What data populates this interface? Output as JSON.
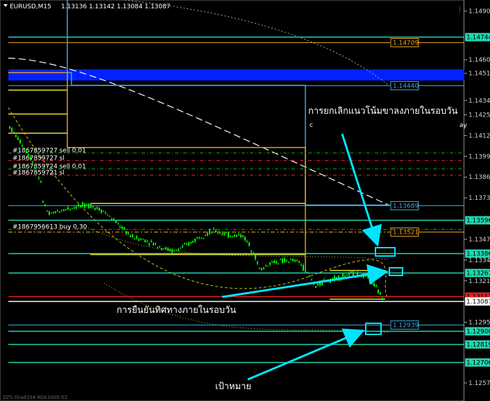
{
  "window": {
    "title": "EURUSD,M15",
    "ohlc": "1.13136 1.13142 1.13084 1.13087",
    "footer_text": "ZZS-Grad334 8DA1005-02",
    "top_right_icon": "scrollbar-marker-icon"
  },
  "chart_data": {
    "type": "candlestick",
    "symbol": "EURUSD",
    "timeframe": "M15",
    "ylim": [
      1.1245,
      1.1498
    ],
    "price_axis_ticks": [
      "1.14905",
      "1.14600",
      "1.14515",
      "1.14345",
      "1.14255",
      "1.14125",
      "1.13995",
      "1.13865",
      "1.13735",
      "1.13605",
      "1.13475",
      "1.13345",
      "1.13215",
      "1.13085",
      "1.12955",
      "1.12825",
      "1.12695",
      "1.12575"
    ],
    "axis_labels": {
      "top": "1.14905",
      "ticks": [
        "1.14600",
        "1.14515",
        "1.14345",
        "1.14255",
        "1.14125",
        "1.13995",
        "1.13865",
        "1.13735",
        "1.13475",
        "1.13345",
        "1.13215",
        "1.12955",
        "1.12575"
      ]
    },
    "horizontal_levels": [
      {
        "price": 1.14744,
        "label": "1.14744",
        "color": "#20d8b0",
        "style": "solid",
        "tag": "axis"
      },
      {
        "price": 1.14709,
        "label": "1.14709",
        "color": "#e0a020",
        "style": "solid",
        "tag": "box"
      },
      {
        "price": 1.1444,
        "label": "1.14440",
        "color": "#3aa8e0",
        "style": "solid",
        "tag": "box"
      },
      {
        "price": 1.13689,
        "label": "1.13689",
        "color": "#3aa8e0",
        "style": "solid",
        "tag": "box"
      },
      {
        "price": 1.13596,
        "label": "1.13596",
        "color": "#20d8b0",
        "style": "solid",
        "tag": "axis"
      },
      {
        "price": 1.13521,
        "label": "1.13521",
        "color": "#e0a020",
        "style": "dashdot",
        "tag": "box"
      },
      {
        "price": 1.13386,
        "label": "1.13386",
        "color": "#20d8b0",
        "style": "solid",
        "tag": "axis"
      },
      {
        "price": 1.13267,
        "label": "1.13267",
        "color": "#20d8b0",
        "style": "solid",
        "tag": "axis"
      },
      {
        "price": 1.13117,
        "label": "1.13117",
        "color": "#e02020",
        "style": "solid",
        "tag": "axis-red"
      },
      {
        "price": 1.13087,
        "label": "1.13087",
        "color": "#ffffff",
        "style": "solid",
        "tag": "axis-white"
      },
      {
        "price": 1.12939,
        "label": "1.12939",
        "color": "#3aa8e0",
        "style": "solid",
        "tag": "box"
      },
      {
        "price": 1.129,
        "label": "1.12900",
        "color": "#20d8b0",
        "style": "solid",
        "tag": "axis"
      },
      {
        "price": 1.12819,
        "label": "1.12819",
        "color": "#20d8b0",
        "style": "solid",
        "tag": "axis"
      },
      {
        "price": 1.12706,
        "label": "1.12706",
        "color": "#20d8b0",
        "style": "solid",
        "tag": "axis"
      }
    ],
    "order_labels": [
      "#1867859727 sell 0.01",
      "#1867859727 sl",
      "#1867859724 sell 0.01",
      "#1867859721 sl",
      "#1867956613 buy 0.30"
    ],
    "order_level_prices": [
      1.1402,
      1.1397,
      1.1392,
      1.1388,
      1.1354
    ],
    "supply_zone": {
      "from": 1.1454,
      "to": 1.1447,
      "color": "#0022ff"
    }
  },
  "annotations": {
    "text1": "การยกเลิกแนวโน้มขาลงภายในรอบวัน",
    "text2": "การยืนยันทิศทางภายในรอบวัน",
    "text3": "เป้าหมาย",
    "c_marker": "c",
    "ay_marker": "ay"
  },
  "colors": {
    "background": "#000000",
    "bull": "#00ff00",
    "level_green": "#20d8b0",
    "level_orange": "#e0a020",
    "level_blue": "#3aa8e0",
    "arrow": "#00e5ff",
    "text": "#ffffff"
  }
}
